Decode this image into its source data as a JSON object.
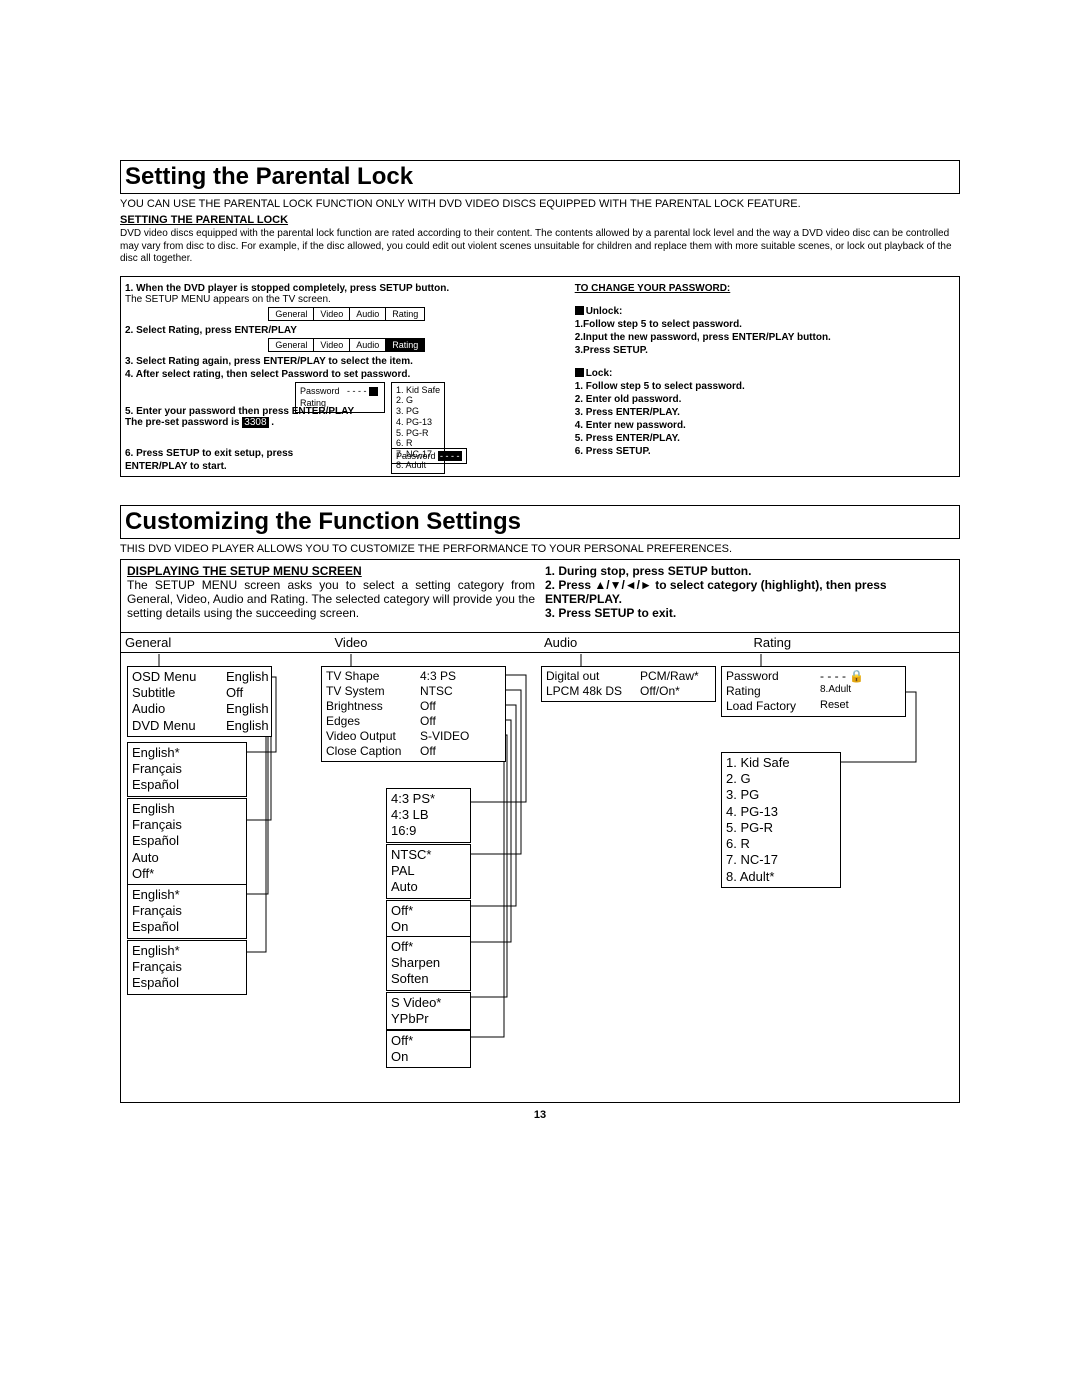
{
  "section1": {
    "title": "Setting the Parental Lock",
    "intro": "YOU CAN USE THE PARENTAL LOCK FUNCTION ONLY WITH DVD VIDEO DISCS EQUIPPED WITH THE PARENTAL LOCK FEATURE.",
    "subhead": "SETTING THE PARENTAL LOCK",
    "body": "DVD video discs equipped with the parental lock function are rated according to their content.  The contents allowed by a parental lock level and the way a DVD video disc can be controlled may vary from disc to disc. For example, if the disc allowed, you could edit out violent scenes unsuitable for children and replace them with more suitable scenes, or lock out playback of the disc all together.",
    "left": {
      "step1": "1. When the DVD player is stopped completely, press SETUP button.",
      "step1b": "The SETUP MENU appears on the TV screen.",
      "tabs": [
        "General",
        "Video",
        "Audio",
        "Rating"
      ],
      "step2": "2. Select Rating, press ENTER/PLAY",
      "step3": "3. Select Rating again, press ENTER/PLAY to select the item.",
      "step4": "4. After select rating, then select Password to set password.",
      "pw_label": "Password",
      "pw_dashes": "- - - -",
      "rating_label": "Rating",
      "step5": "5. Enter your password then press ENTER/PLAY",
      "preset_a": "The pre-set password is",
      "preset_b": "3308",
      "preset_c": ".",
      "step6a": "6. Press SETUP to exit setup, press",
      "step6b": "ENTER/PLAY to start.",
      "pw2_label": "Password",
      "pw2_val": "- - - -",
      "ratings_list": [
        "1. Kid Safe",
        "2. G",
        "3. PG",
        "4. PG-13",
        "5. PG-R",
        "6. R",
        "7. NC-17",
        "8. Adult"
      ]
    },
    "right": {
      "head": "TO CHANGE YOUR PASSWORD:",
      "unlock_label": "Unlock:",
      "unlock_steps": [
        "1.Follow step 5 to select password.",
        "2.Input the new password, press ENTER/PLAY button.",
        "3.Press SETUP."
      ],
      "lock_label": "Lock:",
      "lock_steps": [
        "1. Follow step 5 to select password.",
        "2. Enter old password.",
        "3. Press ENTER/PLAY.",
        "4. Enter new password.",
        "5. Press ENTER/PLAY.",
        "6. Press SETUP."
      ]
    }
  },
  "section2": {
    "title": "Customizing the Function Settings",
    "intro": "THIS DVD VIDEO PLAYER ALLOWS YOU TO CUSTOMIZE THE PERFORMANCE TO YOUR PERSONAL PREFERENCES.",
    "left_head": "DISPLAYING THE SETUP MENU SCREEN",
    "left_body": "The SETUP MENU screen asks you to select a setting category from General, Video, Audio and Rating. The selected category will provide you the setting details using the succeeding screen.",
    "right_steps": [
      "1. During stop, press SETUP button.",
      "2. Press ▲/▼/◄/►  to select category (highlight), then press ENTER/PLAY.",
      "3. Press SETUP to exit."
    ]
  },
  "diagram": {
    "cats": [
      "General",
      "Video",
      "Audio",
      "Rating"
    ],
    "general": {
      "rows": [
        [
          "OSD Menu",
          "English"
        ],
        [
          "Subtitle",
          "Off"
        ],
        [
          "Audio",
          "English"
        ],
        [
          "DVD Menu",
          "English"
        ]
      ],
      "opt1": [
        "English*",
        "Français",
        "Español"
      ],
      "opt2": [
        "English",
        "Français",
        "Español",
        "Auto",
        "Off*"
      ],
      "opt3": [
        "English*",
        "Français",
        "Español"
      ],
      "opt4": [
        "English*",
        "Français",
        "Español"
      ]
    },
    "video": {
      "rows": [
        [
          "TV Shape",
          "4:3   PS"
        ],
        [
          "TV System",
          "NTSC"
        ],
        [
          "Brightness",
          "Off"
        ],
        [
          "Edges",
          "Off"
        ],
        [
          "Video Output",
          "S-VIDEO"
        ],
        [
          "Close Caption",
          "Off"
        ]
      ],
      "opt1": [
        "4:3   PS*",
        "4:3   LB",
        "16:9"
      ],
      "opt2": [
        "NTSC*",
        "PAL",
        "Auto"
      ],
      "opt3": [
        "Off*",
        "On"
      ],
      "opt4": [
        "Off*",
        "Sharpen",
        "Soften"
      ],
      "opt5": [
        "S Video*",
        "YPbPr"
      ],
      "opt6": [
        "Off*",
        "On"
      ]
    },
    "audio": {
      "rows": [
        [
          "Digital out",
          "PCM/Raw*"
        ],
        [
          "LPCM 48k DS",
          "Off/On*"
        ]
      ]
    },
    "rating": {
      "rows": [
        [
          "Password",
          "- - - -"
        ],
        [
          "Rating",
          "8.Adult"
        ],
        [
          "Load Factory",
          "Reset"
        ]
      ],
      "lockicon": "🔒",
      "opt": [
        "1. Kid Safe",
        "2. G",
        "3. PG",
        "4. PG-13",
        "5. PG-R",
        "6. R",
        "7. NC-17",
        "8. Adult*"
      ]
    }
  },
  "page_number": "13"
}
